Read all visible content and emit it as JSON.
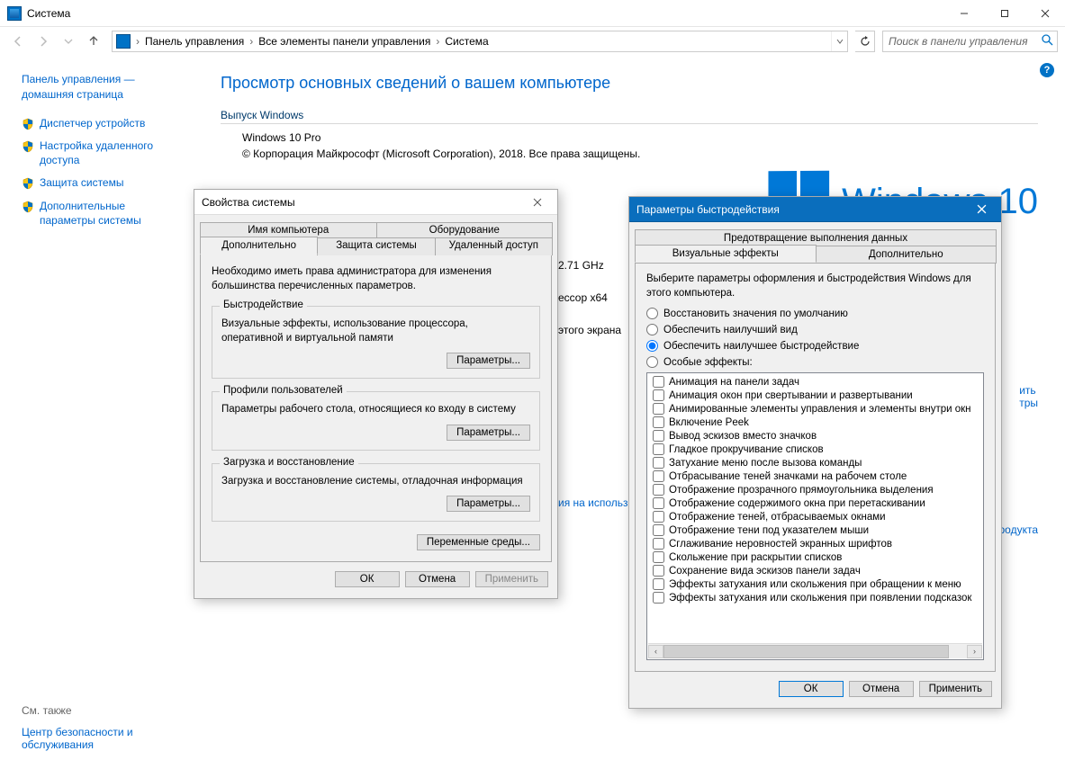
{
  "window": {
    "title": "Система"
  },
  "win_ctrl": {
    "min": "—",
    "max": "☐",
    "close": "✕"
  },
  "breadcrumb": {
    "item1": "Панель управления",
    "item2": "Все элементы панели управления",
    "item3": "Система"
  },
  "search": {
    "placeholder": "Поиск в панели управления"
  },
  "sidebar": {
    "home": "Панель управления — домашняя страница",
    "links": [
      "Диспетчер устройств",
      "Настройка удаленного доступа",
      "Защита системы",
      "Дополнительные параметры системы"
    ],
    "see_also_label": "См. также",
    "see_also_link": "Центр безопасности и обслуживания"
  },
  "main": {
    "title": "Просмотр основных сведений о вашем компьютере",
    "edition_section": "Выпуск Windows",
    "edition": "Windows 10 Pro",
    "copyright": "© Корпорация Майкрософт (Microsoft Corporation), 2018. Все права защищены.",
    "win10_text": "Windows 10",
    "cpu_tail": "2.71 GHz",
    "proc_type": "ессор x64",
    "screen_tail": "этого экрана",
    "link_change1a": "ить",
    "link_change1b": "тры",
    "link_license": "ия на использ",
    "link_product": "продукта"
  },
  "sysprop": {
    "title": "Свойства системы",
    "tabs_row1": {
      "a": "Имя компьютера",
      "b": "Оборудование"
    },
    "tabs_row2": {
      "a": "Дополнительно",
      "b": "Защита системы",
      "c": "Удаленный доступ"
    },
    "admin_note": "Необходимо иметь права администратора для изменения большинства перечисленных параметров.",
    "gb1_title": "Быстродействие",
    "gb1_text": "Визуальные эффекты, использование процессора, оперативной и виртуальной памяти",
    "btn_params": "Параметры...",
    "gb2_title": "Профили пользователей",
    "gb2_text": "Параметры рабочего стола, относящиеся ко входу в систему",
    "gb3_title": "Загрузка и восстановление",
    "gb3_text": "Загрузка и восстановление системы, отладочная информация",
    "env_btn": "Переменные среды...",
    "ok": "ОК",
    "cancel": "Отмена",
    "apply": "Применить"
  },
  "perf": {
    "title": "Параметры быстродействия",
    "tabs": {
      "a": "Визуальные эффекты",
      "b": "Дополнительно",
      "c": "Предотвращение выполнения данных"
    },
    "intro": "Выберите параметры оформления и быстродействия Windows для этого компьютера.",
    "radio1": "Восстановить значения по умолчанию",
    "radio2": "Обеспечить наилучший вид",
    "radio3": "Обеспечить наилучшее быстродействие",
    "radio4": "Особые эффекты:",
    "effects": [
      "Анимация на панели задач",
      "Анимация окон при свертывании и развертывании",
      "Анимированные элементы управления и элементы внутри окн",
      "Включение Peek",
      "Вывод эскизов вместо значков",
      "Гладкое прокручивание списков",
      "Затухание меню после вызова команды",
      "Отбрасывание теней значками на рабочем столе",
      "Отображение прозрачного прямоугольника выделения",
      "Отображение содержимого окна при перетаскивании",
      "Отображение теней, отбрасываемых окнами",
      "Отображение тени под указателем мыши",
      "Сглаживание неровностей экранных шрифтов",
      "Скольжение при раскрытии списков",
      "Сохранение вида эскизов панели задач",
      "Эффекты затухания или скольжения при обращении к меню",
      "Эффекты затухания или скольжения при появлении подсказок"
    ],
    "ok": "ОК",
    "cancel": "Отмена",
    "apply": "Применить"
  }
}
